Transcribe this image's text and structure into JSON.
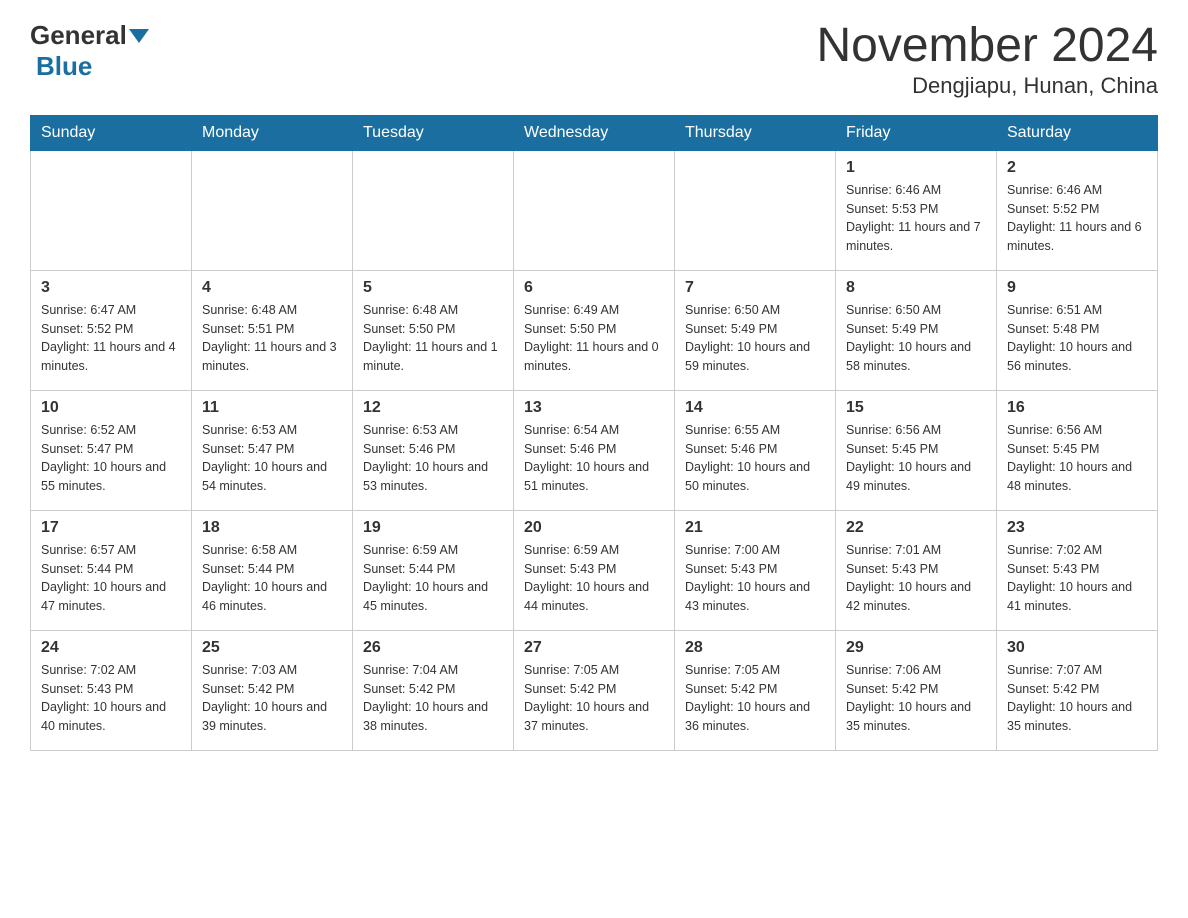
{
  "header": {
    "logo": {
      "text1": "General",
      "text2": "Blue"
    },
    "title": "November 2024",
    "location": "Dengjiapu, Hunan, China"
  },
  "weekdays": [
    "Sunday",
    "Monday",
    "Tuesday",
    "Wednesday",
    "Thursday",
    "Friday",
    "Saturday"
  ],
  "weeks": [
    [
      {
        "day": "",
        "info": ""
      },
      {
        "day": "",
        "info": ""
      },
      {
        "day": "",
        "info": ""
      },
      {
        "day": "",
        "info": ""
      },
      {
        "day": "",
        "info": ""
      },
      {
        "day": "1",
        "info": "Sunrise: 6:46 AM\nSunset: 5:53 PM\nDaylight: 11 hours and 7 minutes."
      },
      {
        "day": "2",
        "info": "Sunrise: 6:46 AM\nSunset: 5:52 PM\nDaylight: 11 hours and 6 minutes."
      }
    ],
    [
      {
        "day": "3",
        "info": "Sunrise: 6:47 AM\nSunset: 5:52 PM\nDaylight: 11 hours and 4 minutes."
      },
      {
        "day": "4",
        "info": "Sunrise: 6:48 AM\nSunset: 5:51 PM\nDaylight: 11 hours and 3 minutes."
      },
      {
        "day": "5",
        "info": "Sunrise: 6:48 AM\nSunset: 5:50 PM\nDaylight: 11 hours and 1 minute."
      },
      {
        "day": "6",
        "info": "Sunrise: 6:49 AM\nSunset: 5:50 PM\nDaylight: 11 hours and 0 minutes."
      },
      {
        "day": "7",
        "info": "Sunrise: 6:50 AM\nSunset: 5:49 PM\nDaylight: 10 hours and 59 minutes."
      },
      {
        "day": "8",
        "info": "Sunrise: 6:50 AM\nSunset: 5:49 PM\nDaylight: 10 hours and 58 minutes."
      },
      {
        "day": "9",
        "info": "Sunrise: 6:51 AM\nSunset: 5:48 PM\nDaylight: 10 hours and 56 minutes."
      }
    ],
    [
      {
        "day": "10",
        "info": "Sunrise: 6:52 AM\nSunset: 5:47 PM\nDaylight: 10 hours and 55 minutes."
      },
      {
        "day": "11",
        "info": "Sunrise: 6:53 AM\nSunset: 5:47 PM\nDaylight: 10 hours and 54 minutes."
      },
      {
        "day": "12",
        "info": "Sunrise: 6:53 AM\nSunset: 5:46 PM\nDaylight: 10 hours and 53 minutes."
      },
      {
        "day": "13",
        "info": "Sunrise: 6:54 AM\nSunset: 5:46 PM\nDaylight: 10 hours and 51 minutes."
      },
      {
        "day": "14",
        "info": "Sunrise: 6:55 AM\nSunset: 5:46 PM\nDaylight: 10 hours and 50 minutes."
      },
      {
        "day": "15",
        "info": "Sunrise: 6:56 AM\nSunset: 5:45 PM\nDaylight: 10 hours and 49 minutes."
      },
      {
        "day": "16",
        "info": "Sunrise: 6:56 AM\nSunset: 5:45 PM\nDaylight: 10 hours and 48 minutes."
      }
    ],
    [
      {
        "day": "17",
        "info": "Sunrise: 6:57 AM\nSunset: 5:44 PM\nDaylight: 10 hours and 47 minutes."
      },
      {
        "day": "18",
        "info": "Sunrise: 6:58 AM\nSunset: 5:44 PM\nDaylight: 10 hours and 46 minutes."
      },
      {
        "day": "19",
        "info": "Sunrise: 6:59 AM\nSunset: 5:44 PM\nDaylight: 10 hours and 45 minutes."
      },
      {
        "day": "20",
        "info": "Sunrise: 6:59 AM\nSunset: 5:43 PM\nDaylight: 10 hours and 44 minutes."
      },
      {
        "day": "21",
        "info": "Sunrise: 7:00 AM\nSunset: 5:43 PM\nDaylight: 10 hours and 43 minutes."
      },
      {
        "day": "22",
        "info": "Sunrise: 7:01 AM\nSunset: 5:43 PM\nDaylight: 10 hours and 42 minutes."
      },
      {
        "day": "23",
        "info": "Sunrise: 7:02 AM\nSunset: 5:43 PM\nDaylight: 10 hours and 41 minutes."
      }
    ],
    [
      {
        "day": "24",
        "info": "Sunrise: 7:02 AM\nSunset: 5:43 PM\nDaylight: 10 hours and 40 minutes."
      },
      {
        "day": "25",
        "info": "Sunrise: 7:03 AM\nSunset: 5:42 PM\nDaylight: 10 hours and 39 minutes."
      },
      {
        "day": "26",
        "info": "Sunrise: 7:04 AM\nSunset: 5:42 PM\nDaylight: 10 hours and 38 minutes."
      },
      {
        "day": "27",
        "info": "Sunrise: 7:05 AM\nSunset: 5:42 PM\nDaylight: 10 hours and 37 minutes."
      },
      {
        "day": "28",
        "info": "Sunrise: 7:05 AM\nSunset: 5:42 PM\nDaylight: 10 hours and 36 minutes."
      },
      {
        "day": "29",
        "info": "Sunrise: 7:06 AM\nSunset: 5:42 PM\nDaylight: 10 hours and 35 minutes."
      },
      {
        "day": "30",
        "info": "Sunrise: 7:07 AM\nSunset: 5:42 PM\nDaylight: 10 hours and 35 minutes."
      }
    ]
  ]
}
